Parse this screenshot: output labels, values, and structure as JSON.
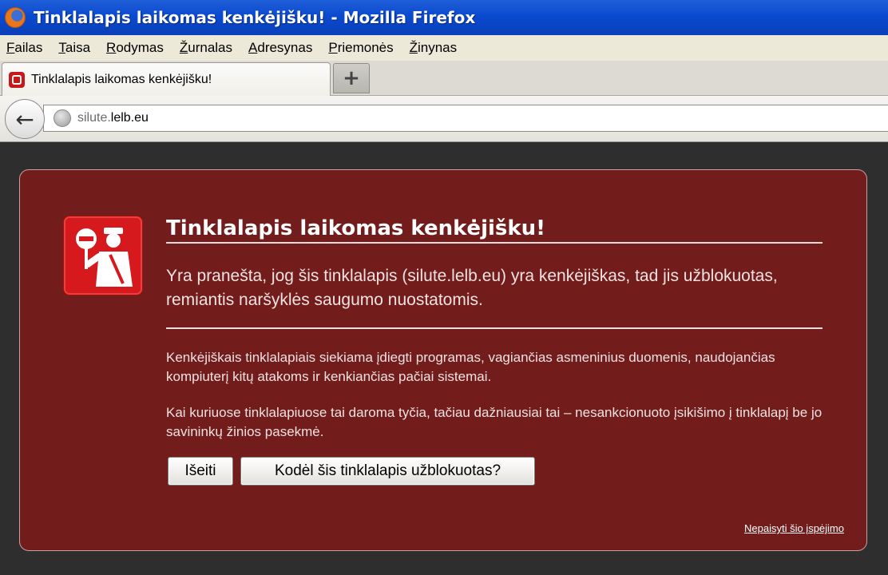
{
  "window": {
    "title": "Tinklalapis laikomas kenkėjišku! - Mozilla Firefox",
    "icon": "firefox-icon"
  },
  "menu": {
    "items": [
      {
        "access_key": "F",
        "rest": "ailas"
      },
      {
        "access_key": "T",
        "rest": "aisa"
      },
      {
        "access_key": "R",
        "rest": "odymas"
      },
      {
        "access_key": "Ž",
        "rest": "urnalas"
      },
      {
        "access_key": "A",
        "rest": "dresynas"
      },
      {
        "access_key": "P",
        "rest": "riemonės"
      },
      {
        "access_key": "Ž",
        "rest": "inynas"
      }
    ]
  },
  "tabs": {
    "active_label": "Tinklalapis laikomas kenkėjišku!",
    "new_tab_label": "+"
  },
  "nav": {
    "back_icon": "back-arrow-icon",
    "back_glyph": "←",
    "url_subdomain": "silute.",
    "url_domain": "lelb.eu"
  },
  "page": {
    "headline": "Tinklalapis laikomas kenkėjišku!",
    "lead": "Yra pranešta, jog šis tinklalapis (silute.lelb.eu) yra kenkėjiškas, tad jis užblokuotas, remiantis naršyklės saugumo nuostatomis.",
    "paragraph1": "Kenkėjiškais tinklalapiais siekiama įdiegti programas, vagiančias asmeninius duomenis, naudojančias kompiuterį kitų atakoms ir kenkiančias pačiai sistemai.",
    "paragraph2": "Kai kuriuose tinklalapiuose tai daroma tyčia, tačiau dažniausiai tai – nesankcionuoto įsikišimo į tinklalapį be jo savininkų žinios pasekmė.",
    "exit_button": "Išeiti",
    "why_button": "Kodėl šis tinklalapis užblokuotas?",
    "ignore_link": "Nepaisyti šio įspėjimo"
  },
  "colors": {
    "panel_bg": "#721c1c",
    "page_bg": "#2e2e2e",
    "icon_red": "#d5191c",
    "titlebar_blue": "#0a4ad0"
  }
}
